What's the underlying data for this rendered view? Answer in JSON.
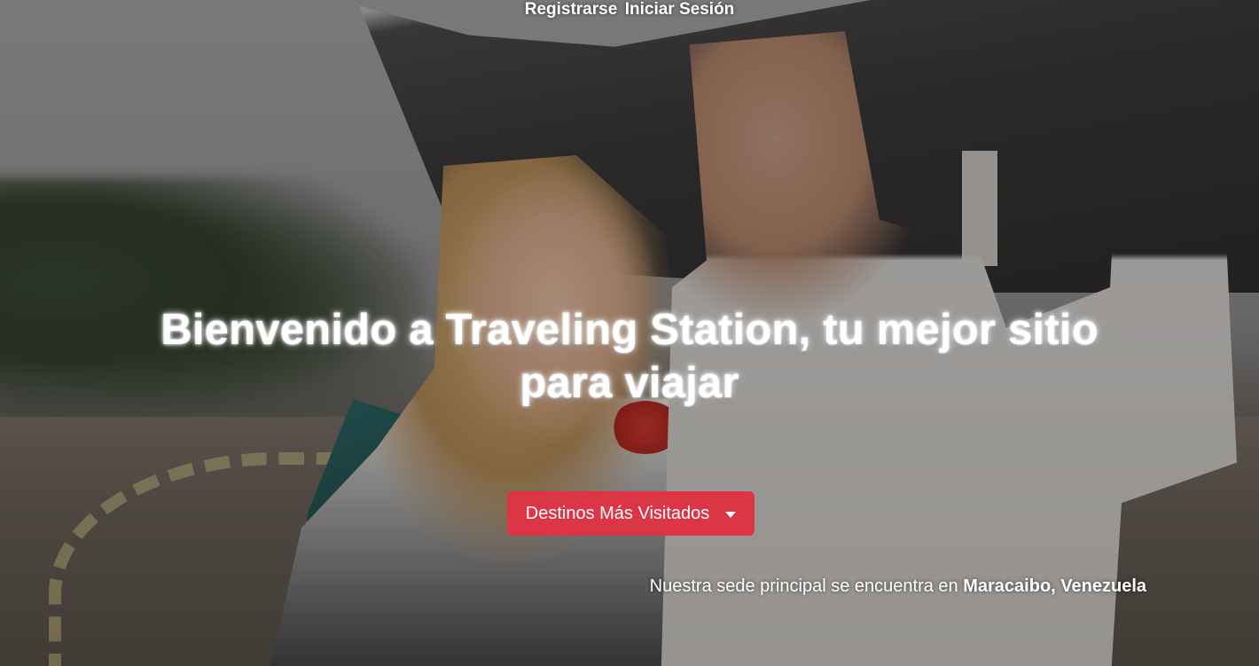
{
  "nav": {
    "register_label": "Registrarse",
    "login_label": "Iniciar Sesión"
  },
  "hero": {
    "headline_line1": "Bienvenido a Traveling Station, tu mejor sitio",
    "headline_line2": "para viajar",
    "image_description_icon": "hero-photo-couple-airport"
  },
  "dropdown": {
    "label": "Destinos Más Visitados",
    "color": "#dc3545"
  },
  "hq": {
    "text": "Nuestra sede principal se encuentra en",
    "location": "Maracaibo, Venezuela"
  }
}
